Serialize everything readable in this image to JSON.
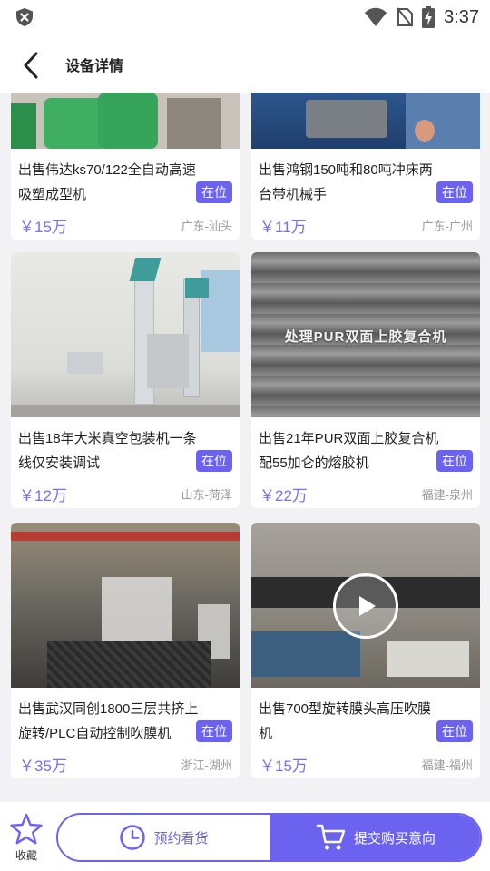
{
  "status_bar": {
    "time": "3:37"
  },
  "header": {
    "title": "设备详情"
  },
  "cards": [
    {
      "title": "出售伟达ks70/122全自动高速吸塑成型机",
      "badge": "在位",
      "price": "￥15万",
      "location": "广东-汕头",
      "image_text": ""
    },
    {
      "title": "出售鸿钢150吨和80吨冲床两台带机械手",
      "badge": "在位",
      "price": "￥11万",
      "location": "广东-广州",
      "image_text": ""
    },
    {
      "title": "出售18年大米真空包装机一条线仅安装调试",
      "badge": "在位",
      "price": "￥12万",
      "location": "山东-菏泽",
      "image_text": ""
    },
    {
      "title": "出售21年PUR双面上胶复合机配55加仑的熔胶机",
      "badge": "在位",
      "price": "￥22万",
      "location": "福建-泉州",
      "image_text": "处理PUR双面上胶复合机"
    },
    {
      "title": "出售武汉同创1800三层共挤上旋转/PLC自动控制吹膜机",
      "badge": "在位",
      "price": "￥35万",
      "location": "浙江-湖州",
      "image_text": ""
    },
    {
      "title": "出售700型旋转膜头高压吹膜机",
      "badge": "在位",
      "price": "￥15万",
      "location": "福建-福州",
      "image_text": ""
    }
  ],
  "bottom_bar": {
    "favorite_label": "收藏",
    "appointment_label": "预约看货",
    "submit_label": "提交购买意向"
  },
  "colors": {
    "accent": "#6b63f0",
    "price": "#7a6ff3"
  }
}
